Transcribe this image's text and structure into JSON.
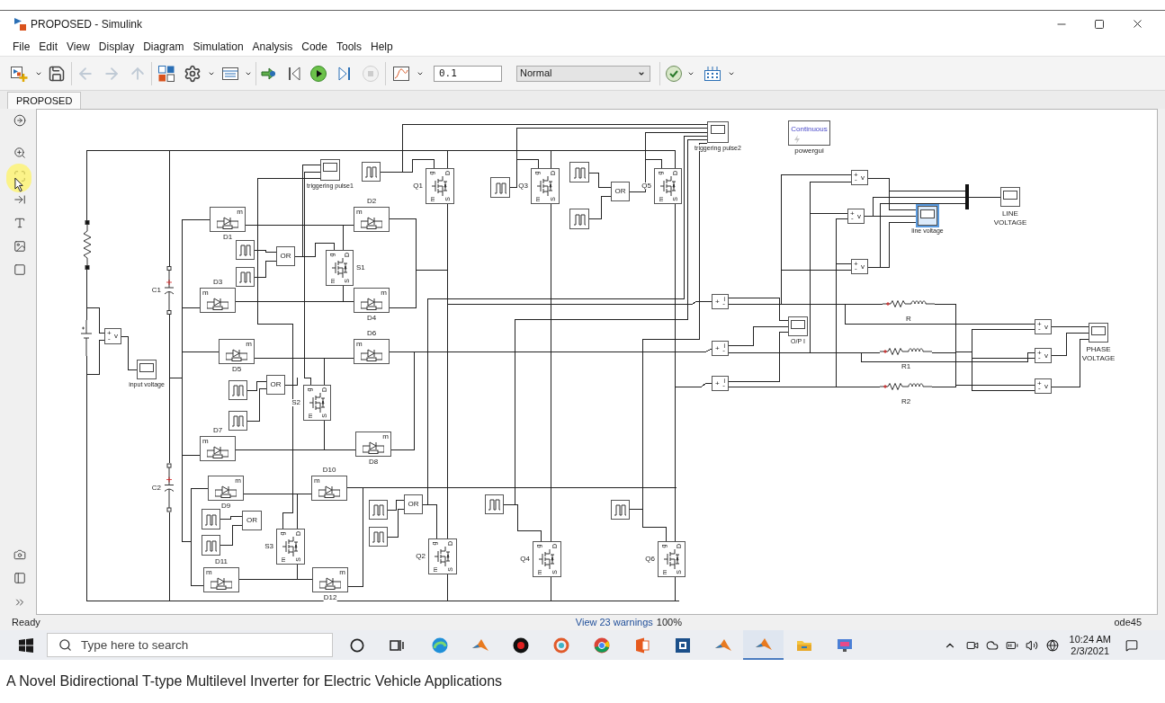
{
  "window": {
    "title": "PROPOSED - Simulink"
  },
  "menu": [
    "File",
    "Edit",
    "View",
    "Display",
    "Diagram",
    "Simulation",
    "Analysis",
    "Code",
    "Tools",
    "Help"
  ],
  "toolbar": {
    "buttons": [
      {
        "disabled": false
      },
      {
        "disabled": false
      },
      {
        "disabled": true
      },
      {
        "disabled": true
      },
      {
        "disabled": true
      },
      {
        "disabled": false
      },
      {
        "disabled": false
      },
      {
        "disabled": false
      },
      {
        "disabled": false
      },
      {
        "disabled": false
      },
      {
        "disabled": false
      },
      {
        "disabled": false
      },
      {
        "disabled": true
      },
      {
        "disabled": false
      },
      {
        "disabled": false
      },
      {
        "disabled": false
      }
    ],
    "stop_time": "0.1",
    "mode": "Normal"
  },
  "tabs": [
    {
      "label": "PROPOSED",
      "selected": true
    }
  ],
  "diagram": {
    "powergui": {
      "text": "Continuous",
      "label": "powergui",
      "selected": false
    },
    "scopes": [
      {
        "label": "triggering pulse2",
        "selected": false
      },
      {
        "label": "triggering pulse1",
        "selected": false
      },
      {
        "label": "line voltage",
        "selected": true
      },
      {
        "label": "LINE VOLTAGE",
        "selected": false
      },
      {
        "label": "O/P I",
        "selected": false
      },
      {
        "label": "PHASE VOLTAGE",
        "selected": false
      },
      {
        "label": "input voltage",
        "selected": false
      }
    ],
    "pulse_generators": [
      {
        "selected": false
      },
      {
        "selected": false
      },
      {
        "selected": false
      },
      {
        "selected": false
      },
      {
        "selected": false
      },
      {
        "selected": false
      },
      {
        "selected": false
      },
      {
        "selected": false
      },
      {
        "selected": false
      },
      {
        "selected": false
      },
      {
        "selected": false
      },
      {
        "selected": false
      },
      {
        "selected": false
      },
      {
        "selected": false
      }
    ],
    "switches": [
      {
        "label": "Q1",
        "ports": [
          "g",
          "D",
          "m",
          "S"
        ],
        "selected": false
      },
      {
        "label": "Q3",
        "ports": [
          "g",
          "D",
          "m",
          "S"
        ],
        "selected": false
      },
      {
        "label": "Q5",
        "ports": [
          "g",
          "D",
          "m",
          "S"
        ],
        "selected": false
      },
      {
        "label": "S1",
        "ports": [
          "g",
          "D",
          "m",
          "S"
        ],
        "selected": false
      },
      {
        "label": "S2",
        "ports": [
          "g",
          "D",
          "m",
          "S"
        ],
        "selected": false
      },
      {
        "label": "S3",
        "ports": [
          "g",
          "D",
          "m",
          "S"
        ],
        "selected": false
      },
      {
        "label": "Q2",
        "ports": [
          "g",
          "D",
          "m",
          "S"
        ],
        "selected": false
      },
      {
        "label": "Q4",
        "ports": [
          "g",
          "D",
          "m",
          "S"
        ],
        "selected": false
      },
      {
        "label": "Q6",
        "ports": [
          "g",
          "D",
          "m",
          "S"
        ],
        "selected": false
      }
    ],
    "diodes": [
      {
        "label": "D1",
        "port": "m",
        "selected": false
      },
      {
        "label": "D2",
        "port": "m",
        "selected": false
      },
      {
        "label": "D3",
        "port": "m",
        "selected": false
      },
      {
        "label": "D4",
        "port": "m",
        "selected": false
      },
      {
        "label": "D5",
        "port": "m",
        "selected": false
      },
      {
        "label": "D6",
        "port": "m",
        "selected": false
      },
      {
        "label": "D7",
        "port": "m",
        "selected": false
      },
      {
        "label": "D8",
        "port": "m",
        "selected": false
      },
      {
        "label": "D9",
        "port": "m",
        "selected": false
      },
      {
        "label": "D10",
        "port": "m",
        "selected": false
      },
      {
        "label": "D11",
        "port": "m",
        "selected": false
      },
      {
        "label": "D12",
        "port": "m",
        "selected": false
      }
    ],
    "or_gates": [
      {
        "text": "OR",
        "selected": false
      },
      {
        "text": "OR",
        "selected": false
      },
      {
        "text": "OR",
        "selected": false
      },
      {
        "text": "OR",
        "selected": false
      },
      {
        "text": "OR",
        "selected": false
      }
    ],
    "voltage_meters": [
      {
        "plus": "+",
        "minus": "-",
        "quantity": "v",
        "selected": false
      },
      {
        "plus": "+",
        "minus": "-",
        "quantity": "v",
        "selected": false
      },
      {
        "plus": "+",
        "minus": "-",
        "quantity": "v",
        "selected": false
      },
      {
        "plus": "+",
        "minus": "-",
        "quantity": "v",
        "selected": false
      },
      {
        "plus": "+",
        "minus": "-",
        "quantity": "v",
        "selected": false
      },
      {
        "plus": "+",
        "minus": "-",
        "quantity": "v",
        "selected": false
      },
      {
        "plus": "+",
        "minus": "-",
        "quantity": "v",
        "selected": false
      }
    ],
    "current_meters": [
      {
        "plus": "+",
        "minus": "-",
        "quantity": "i",
        "selected": false
      },
      {
        "plus": "+",
        "minus": "-",
        "quantity": "i",
        "selected": false
      },
      {
        "plus": "+",
        "minus": "-",
        "quantity": "i",
        "selected": false
      }
    ],
    "rl_branches": [
      {
        "label": "R",
        "selected": false
      },
      {
        "label": "R1",
        "selected": false
      },
      {
        "label": "R2",
        "selected": false
      }
    ],
    "capacitors": [
      {
        "label": "C1",
        "selected": false
      },
      {
        "label": "C2",
        "selected": false
      }
    ],
    "resistor": {
      "selected": false
    },
    "dc_source": {
      "selected": false
    },
    "mux": {
      "selected": false
    }
  },
  "status_bar": {
    "message": "Ready",
    "warnings": "View 23 warnings",
    "zoom": "100%",
    "solver": "ode45"
  },
  "taskbar": {
    "search": {
      "placeholder": "Type here to search"
    },
    "apps": [
      {
        "selected": false
      },
      {
        "selected": false
      },
      {
        "selected": false
      },
      {
        "selected": false
      },
      {
        "selected": false
      },
      {
        "selected": false
      },
      {
        "selected": false
      },
      {
        "selected": false
      },
      {
        "selected": true
      },
      {
        "selected": false
      },
      {
        "selected": false
      }
    ],
    "time": "10:24 AM",
    "date": "2/3/2021"
  },
  "caption": "A Novel Bidirectional T-type Multilevel Inverter for Electric Vehicle Applications"
}
